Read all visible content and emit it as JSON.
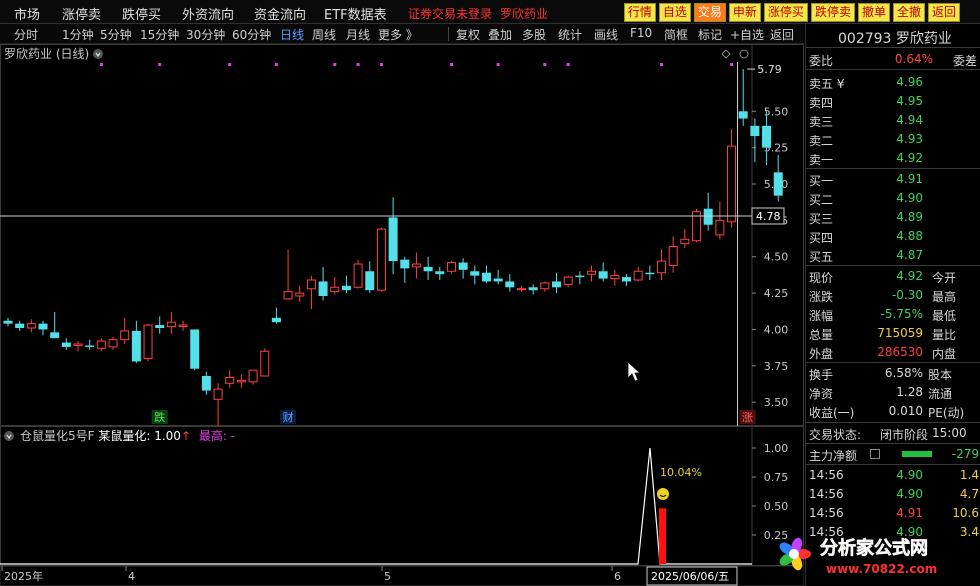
{
  "menu": {
    "items": [
      "市场",
      "涨停卖",
      "跌停买",
      "外资流向",
      "资金流向",
      "ETF数据表"
    ],
    "broker_label": "证券交易未登录",
    "stock_name": "罗欣药业"
  },
  "toolbar": {
    "buttons": [
      "行情",
      "自选",
      "交易",
      "申新",
      "涨停买",
      "跌停卖",
      "撤单",
      "全撤",
      "返回"
    ],
    "active": "交易"
  },
  "periods": {
    "items": [
      "分时",
      "1分钟",
      "5分钟",
      "15分钟",
      "30分钟",
      "60分钟",
      "日线",
      "周线",
      "月线",
      "更多 》"
    ],
    "active": "日线"
  },
  "tools": [
    "复权",
    "叠加",
    "多股",
    "统计",
    "画线",
    "F10",
    "简框",
    "标记",
    "+自选",
    "返回"
  ],
  "chart_title": "罗欣药业 (日线)",
  "indicator": {
    "name": "仓鼠量化5号F",
    "label": "某鼠量化:",
    "value": "1.00",
    "arrow": "↑",
    "max_label": "最高: -"
  },
  "chart_data": {
    "type": "candlestick",
    "price_axis": {
      "min": 3.35,
      "max": 5.88,
      "ticks": [
        3.5,
        3.75,
        4.0,
        4.25,
        4.5,
        4.75,
        5.0,
        5.25,
        5.5
      ]
    },
    "crosshair_price": "4.78",
    "crosshair_date": "2025/06/06/五",
    "high_label": "5.79",
    "low_label": "3.28",
    "markers": [
      "跌",
      "财",
      "涨"
    ],
    "x_labels": [
      "2025年",
      "4",
      "5",
      "6"
    ],
    "candles": [
      [
        4.06,
        4.08,
        4.02,
        4.04
      ],
      [
        4.04,
        4.06,
        3.99,
        4.01
      ],
      [
        4.01,
        4.07,
        3.98,
        4.04
      ],
      [
        4.04,
        4.06,
        3.96,
        4.0
      ],
      [
        3.98,
        4.12,
        3.95,
        3.94
      ],
      [
        3.91,
        3.94,
        3.86,
        3.88
      ],
      [
        3.89,
        3.92,
        3.85,
        3.9
      ],
      [
        3.89,
        3.93,
        3.86,
        3.88
      ],
      [
        3.87,
        3.94,
        3.85,
        3.92
      ],
      [
        3.88,
        3.95,
        3.86,
        3.93
      ],
      [
        3.93,
        4.08,
        3.9,
        3.99
      ],
      [
        3.99,
        4.06,
        3.77,
        3.78
      ],
      [
        3.8,
        4.04,
        3.78,
        4.03
      ],
      [
        4.03,
        4.09,
        3.97,
        4.01
      ],
      [
        4.02,
        4.12,
        3.97,
        4.05
      ],
      [
        4.02,
        4.06,
        3.99,
        4.03
      ],
      [
        4.0,
        4.0,
        3.72,
        3.73
      ],
      [
        3.68,
        3.71,
        3.55,
        3.58
      ],
      [
        3.52,
        3.63,
        3.29,
        3.59
      ],
      [
        3.63,
        3.72,
        3.6,
        3.67
      ],
      [
        3.64,
        3.69,
        3.6,
        3.65
      ],
      [
        3.64,
        3.72,
        3.62,
        3.72
      ],
      [
        3.68,
        3.87,
        3.68,
        3.85
      ],
      [
        4.08,
        4.15,
        4.04,
        4.05
      ],
      [
        4.21,
        4.55,
        4.2,
        4.26
      ],
      [
        4.23,
        4.3,
        4.19,
        4.25
      ],
      [
        4.28,
        4.37,
        4.14,
        4.34
      ],
      [
        4.33,
        4.43,
        4.2,
        4.23
      ],
      [
        4.26,
        4.36,
        4.24,
        4.29
      ],
      [
        4.3,
        4.37,
        4.25,
        4.27
      ],
      [
        4.29,
        4.48,
        4.28,
        4.45
      ],
      [
        4.4,
        4.47,
        4.25,
        4.27
      ],
      [
        4.27,
        4.7,
        4.26,
        4.69
      ],
      [
        4.77,
        4.91,
        4.38,
        4.47
      ],
      [
        4.48,
        4.5,
        4.32,
        4.42
      ],
      [
        4.43,
        4.53,
        4.35,
        4.45
      ],
      [
        4.43,
        4.5,
        4.34,
        4.4
      ],
      [
        4.4,
        4.43,
        4.34,
        4.38
      ],
      [
        4.4,
        4.47,
        4.38,
        4.46
      ],
      [
        4.46,
        4.49,
        4.35,
        4.41
      ],
      [
        4.4,
        4.44,
        4.31,
        4.37
      ],
      [
        4.39,
        4.44,
        4.32,
        4.33
      ],
      [
        4.35,
        4.41,
        4.31,
        4.33
      ],
      [
        4.33,
        4.38,
        4.26,
        4.29
      ],
      [
        4.28,
        4.3,
        4.26,
        4.28
      ],
      [
        4.29,
        4.31,
        4.24,
        4.27
      ],
      [
        4.28,
        4.33,
        4.26,
        4.32
      ],
      [
        4.33,
        4.39,
        4.25,
        4.29
      ],
      [
        4.31,
        4.37,
        4.29,
        4.36
      ],
      [
        4.37,
        4.4,
        4.31,
        4.36
      ],
      [
        4.38,
        4.44,
        4.33,
        4.4
      ],
      [
        4.4,
        4.46,
        4.33,
        4.35
      ],
      [
        4.35,
        4.41,
        4.3,
        4.37
      ],
      [
        4.36,
        4.38,
        4.3,
        4.33
      ],
      [
        4.34,
        4.43,
        4.33,
        4.4
      ],
      [
        4.39,
        4.44,
        4.34,
        4.38
      ],
      [
        4.39,
        4.55,
        4.34,
        4.47
      ],
      [
        4.44,
        4.64,
        4.39,
        4.57
      ],
      [
        4.59,
        4.69,
        4.56,
        4.62
      ],
      [
        4.61,
        4.83,
        4.6,
        4.81
      ],
      [
        4.83,
        4.94,
        4.68,
        4.72
      ],
      [
        4.65,
        4.88,
        4.62,
        4.75
      ],
      [
        4.74,
        5.38,
        4.7,
        5.26
      ],
      [
        5.5,
        5.79,
        5.4,
        5.45
      ],
      [
        5.4,
        5.45,
        5.15,
        5.33
      ],
      [
        5.4,
        5.5,
        5.13,
        5.25
      ],
      [
        5.08,
        5.2,
        4.88,
        4.92
      ]
    ],
    "top_markers": [
      8,
      13,
      19,
      23,
      28,
      30,
      32,
      38,
      42,
      46,
      48,
      56,
      62
    ],
    "indicator_series": {
      "peak": 1.0,
      "peak_index": 63,
      "bar_value": 0.48,
      "label": "10.04%"
    }
  },
  "quote": {
    "code": "002793",
    "name": "罗欣药业",
    "weibi_label": "委比",
    "weibi_value": "0.64%",
    "weicha_label": "委差",
    "asks": [
      {
        "label": "卖五 ¥",
        "price": "4.96"
      },
      {
        "label": "卖四",
        "price": "4.95"
      },
      {
        "label": "卖三",
        "price": "4.94"
      },
      {
        "label": "卖二",
        "price": "4.93"
      },
      {
        "label": "卖一",
        "price": "4.92"
      }
    ],
    "bids": [
      {
        "label": "买一",
        "price": "4.91"
      },
      {
        "label": "买二",
        "price": "4.90"
      },
      {
        "label": "买三",
        "price": "4.89"
      },
      {
        "label": "买四",
        "price": "4.88"
      },
      {
        "label": "买五",
        "price": "4.87"
      }
    ],
    "stats": [
      {
        "l": "现价",
        "v": "4.92",
        "r": "今开",
        "cls": "green"
      },
      {
        "l": "涨跌",
        "v": "-0.30",
        "r": "最高",
        "cls": "green"
      },
      {
        "l": "涨幅",
        "v": "-5.75%",
        "r": "最低",
        "cls": "green"
      },
      {
        "l": "总量",
        "v": "715059",
        "r": "量比",
        "cls": "yellow"
      },
      {
        "l": "外盘",
        "v": "286530",
        "r": "内盘",
        "cls": "red"
      }
    ],
    "stats2": [
      {
        "l": "换手",
        "v": "6.58%",
        "r": "股本"
      },
      {
        "l": "净资",
        "v": "1.28",
        "r": "流通"
      },
      {
        "l": "收益(一)",
        "v": "0.010",
        "r": "PE(动)"
      }
    ],
    "trade_status_label": "交易状态:",
    "trade_status": "闭市阶段",
    "trade_time": "15:00",
    "net_label": "主力净额",
    "net_value": "-279",
    "ticks": [
      {
        "t": "14:56",
        "p": "4.90",
        "v": "1.4"
      },
      {
        "t": "14:56",
        "p": "4.90",
        "v": "4.7"
      },
      {
        "t": "14:56",
        "p": "4.91",
        "v": "10.6"
      },
      {
        "t": "14:56",
        "p": "4.90",
        "v": "3.4"
      }
    ]
  },
  "watermark": {
    "text": "分析家公式网",
    "url": "www.70822.com"
  }
}
